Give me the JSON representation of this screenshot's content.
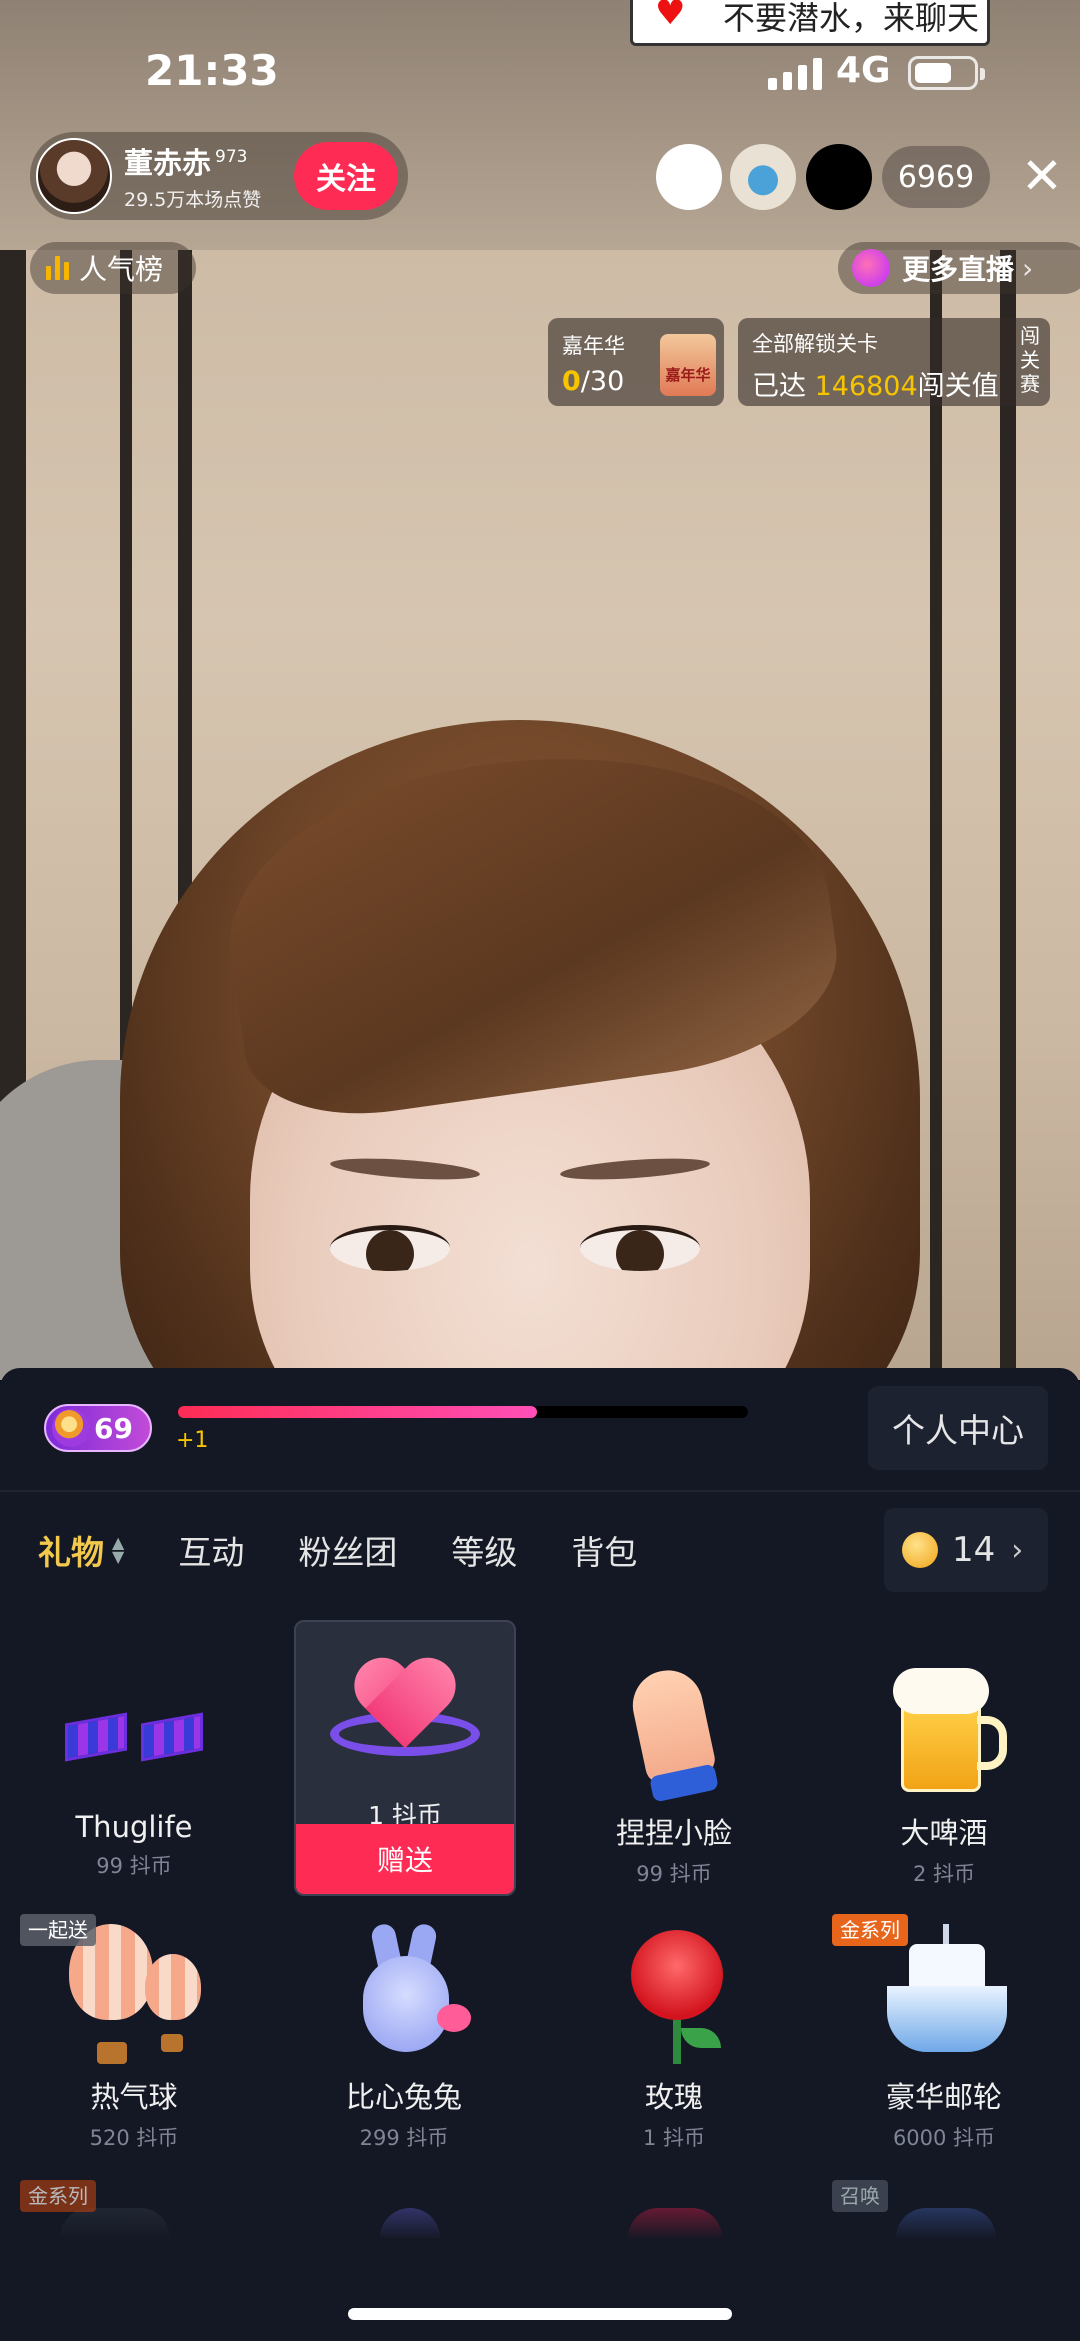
{
  "status_bar": {
    "time": "21:33",
    "network": "4G"
  },
  "chat_bubble": {
    "text": "不要潜水，来聊天"
  },
  "host": {
    "name": "董赤赤",
    "level": "973",
    "likes": "29.5万本场点赞",
    "follow_label": "关注"
  },
  "viewers": {
    "count": "6969"
  },
  "rank": {
    "label": "人气榜"
  },
  "more_live": {
    "label": "更多直播",
    "chevron": "›"
  },
  "carnival": {
    "title": "嘉年华",
    "current": "0",
    "total": "/30",
    "badge": "嘉年华"
  },
  "unlock": {
    "title": "全部解锁关卡",
    "prefix": "已达",
    "value": "146804",
    "suffix": "闯关值",
    "side_label": "闯关赛"
  },
  "level": {
    "value": "69",
    "progress": 0.63,
    "gain": "+1"
  },
  "personal_center": {
    "label": "个人中心"
  },
  "tabs": [
    {
      "label": "礼物",
      "active": true
    },
    {
      "label": "互动"
    },
    {
      "label": "粉丝团"
    },
    {
      "label": "等级"
    },
    {
      "label": "背包"
    }
  ],
  "coins": {
    "balance": "14",
    "chevron": "›"
  },
  "gifts": [
    {
      "name": "Thuglife",
      "price": "99 抖币",
      "icon": "glasses-icon"
    },
    {
      "name": "",
      "price": "1 抖币",
      "icon": "heart-ring-icon",
      "selected": true,
      "send_label": "赠送"
    },
    {
      "name": "捏捏小脸",
      "price": "99 抖币",
      "icon": "hand-icon"
    },
    {
      "name": "大啤酒",
      "price": "2 抖币",
      "icon": "beer-icon"
    },
    {
      "name": "热气球",
      "price": "520 抖币",
      "icon": "balloon-icon",
      "tag": "一起送"
    },
    {
      "name": "比心兔兔",
      "price": "299 抖币",
      "icon": "bunny-icon"
    },
    {
      "name": "玫瑰",
      "price": "1 抖币",
      "icon": "rose-icon"
    },
    {
      "name": "豪华邮轮",
      "price": "6000 抖币",
      "icon": "cruise-ship-icon",
      "tag": "金系列"
    }
  ],
  "row3_tags": {
    "left": "金系列",
    "right": "召唤"
  },
  "colors": {
    "accent_pink": "#fe2c55",
    "gold": "#f7c400",
    "panel_bg": "#141824"
  }
}
